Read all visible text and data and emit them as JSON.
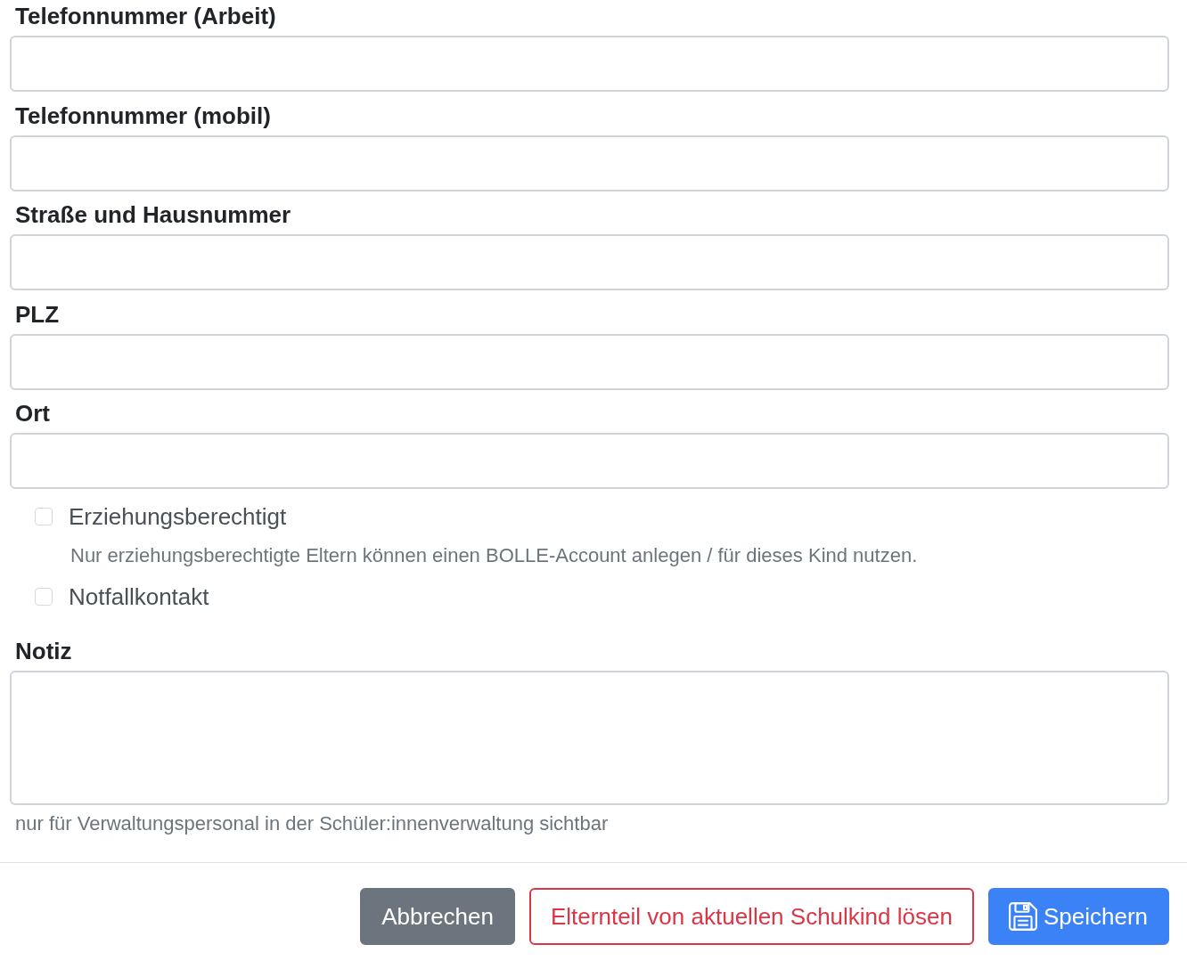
{
  "fields": [
    {
      "kind": "input",
      "label": "Telefonnummer (Arbeit)"
    },
    {
      "kind": "input",
      "label": "Telefonnummer (mobil)"
    },
    {
      "kind": "input",
      "label": "Straße und Hausnummer"
    },
    {
      "kind": "input",
      "label": "PLZ"
    },
    {
      "kind": "input",
      "label": "Ort"
    },
    {
      "kind": "checkbox",
      "label": "Erziehungsberechtigt",
      "checked": false,
      "help": "Nur erziehungsberechtigte Eltern können einen BOLLE-Account anlegen / für dieses Kind nutzen."
    },
    {
      "kind": "checkbox",
      "label": "Notfallkontakt",
      "checked": false
    },
    {
      "kind": "textarea",
      "label": "Notiz",
      "help": "nur für Verwaltungspersonal in der Schüler:innenverwaltung sichtbar"
    }
  ],
  "buttons": [
    {
      "kind": "cancel",
      "label": "Abbrechen"
    },
    {
      "kind": "danger",
      "label": "Elternteil von aktuellen Schulkind lösen"
    },
    {
      "kind": "save",
      "label": "Speichern"
    }
  ]
}
